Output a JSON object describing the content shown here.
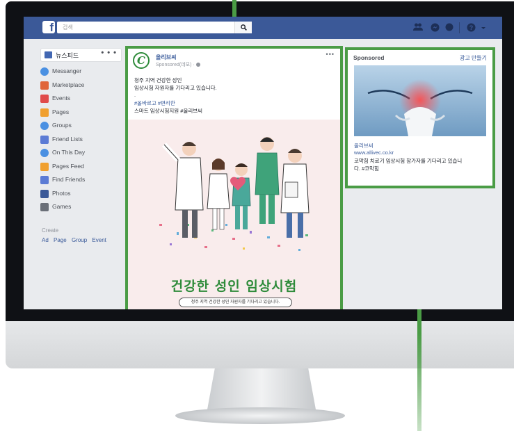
{
  "topbar": {
    "search_placeholder": "검색",
    "logo": "f"
  },
  "sidebar": {
    "newsfeed_label": "뉴스피드",
    "more": "• • •",
    "items": [
      {
        "label": "Messanger",
        "icon": "messenger-icon",
        "color": "#4a90e2"
      },
      {
        "label": "Marketplace",
        "icon": "marketplace-icon",
        "color": "#e0653a"
      },
      {
        "label": "Events",
        "icon": "calendar-icon",
        "color": "#e04b4b"
      },
      {
        "label": "Pages",
        "icon": "flag-icon",
        "color": "#f0a030"
      },
      {
        "label": "Groups",
        "icon": "groups-icon",
        "color": "#4a90e2"
      },
      {
        "label": "Friend Lists",
        "icon": "friends-icon",
        "color": "#5b7bd5"
      },
      {
        "label": "On This Day",
        "icon": "clock-icon",
        "color": "#4a90e2"
      },
      {
        "label": "Pages Feed",
        "icon": "pages-feed-icon",
        "color": "#f0a030"
      },
      {
        "label": "Find Friends",
        "icon": "find-friends-icon",
        "color": "#5b7bd5"
      },
      {
        "label": "Photos",
        "icon": "photos-icon",
        "color": "#3b5998"
      },
      {
        "label": "Games",
        "icon": "games-icon",
        "color": "#6a6f78"
      }
    ],
    "create_label": "Create",
    "create_links": [
      "Ad",
      "Page",
      "Group",
      "Event"
    ]
  },
  "post": {
    "page_name": "올리브씨",
    "sponsored": "Sponsored(데모) · ",
    "more": "•••",
    "lines": [
      "청주 지역 건강한 성인",
      "임상시험 자원자를 기다리고 있습니다.",
      ".",
      "#올바르고 #편리한",
      "스마트 임상시험지원 #올리브씨"
    ],
    "headline": "건강한 성인 임상시험",
    "pill_text": "청주 지역 건강한 성인 자원자를 기다리고 있습니다."
  },
  "ad": {
    "heading": "Sponsored",
    "create_ad": "광고 만들기",
    "name": "올리브씨",
    "url": "www.allivec.co.kr",
    "desc1": "코막힘 치료기 임상시험 참가자를 기다리고 있습니",
    "desc2": "다. #코막힘"
  },
  "colors": {
    "facebook_blue": "#3b5998",
    "highlight_green": "#4a9c45",
    "brand_green": "#2e8b3a"
  }
}
